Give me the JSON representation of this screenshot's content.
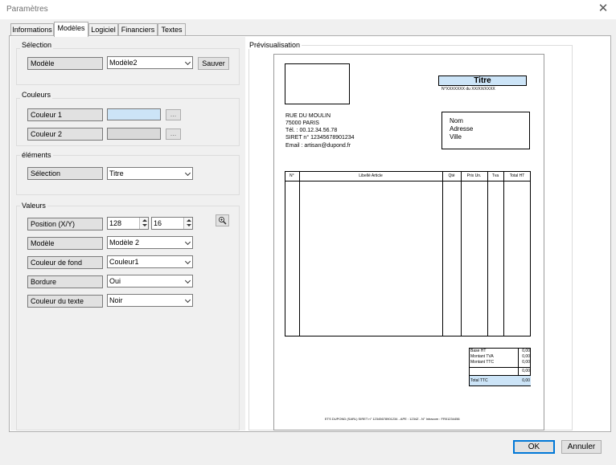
{
  "window": {
    "title": "Paramètres",
    "close_label": "✕"
  },
  "tabs": [
    "Informations",
    "Modèles",
    "Logiciel",
    "Financiers",
    "Textes"
  ],
  "selection_group": {
    "title": "Sélection",
    "label": "Modèle",
    "value": "Modèle2",
    "save_label": "Sauver"
  },
  "colors_group": {
    "title": "Couleurs",
    "color1_label": "Couleur 1",
    "color1_hex": "#cce4f7",
    "color2_label": "Couleur 2",
    "color2_hex": "#d9d9d9",
    "browse_label": "..."
  },
  "elements_group": {
    "title": "éléments",
    "label": "Sélection",
    "value": "Titre"
  },
  "values_group": {
    "title": "Valeurs",
    "position_label": "Position (X/Y)",
    "x_value": "128",
    "y_value": "16",
    "model_label": "Modèle",
    "model_value": "Modèle 2",
    "bg_label": "Couleur de fond",
    "bg_value": "Couleur1",
    "border_label": "Bordure",
    "border_value": "Oui",
    "textcolor_label": "Couleur du texte",
    "textcolor_value": "Noir"
  },
  "preview": {
    "title": "Prévisualisation",
    "doc_title": "Titre",
    "doc_number": "N°XXXXXXX  du  XX/XX/XXXX",
    "sender": [
      "RUE DU MOULIN",
      "75000 PARIS",
      "Tél. : 00.12.34.56.78",
      "SIRET n° 12345678901234",
      "Email : artisan@dupond.fr"
    ],
    "client": [
      "Nom",
      "Adresse",
      "Ville"
    ],
    "table_headers": [
      "N°",
      "Libellé Article",
      "Qté",
      "Prix Un.",
      "Tva",
      "Total HT"
    ],
    "totals_labels": [
      "Base HT",
      "Montant TVA",
      "Montant TTC",
      "",
      "Total TTC"
    ],
    "totals_values": [
      "0,00",
      "0,00",
      "0,00",
      "0,00",
      "0,00"
    ],
    "footer_text": "ETS DUPOND (SARL) SIRET n° 12345678901234 - APE : 1234Z - N° Intracom : FR01234456"
  },
  "buttons": {
    "ok": "OK",
    "cancel": "Annuler"
  }
}
